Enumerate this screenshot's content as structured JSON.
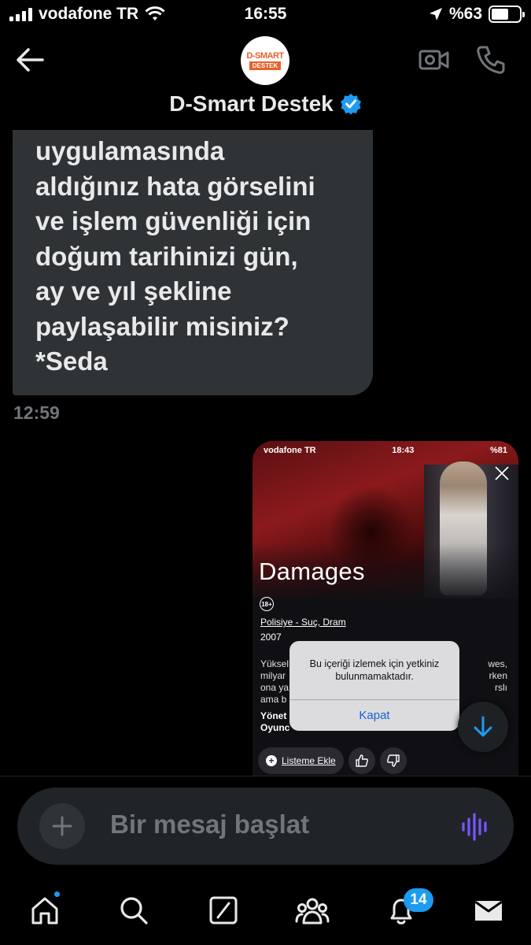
{
  "status_bar": {
    "carrier": "vodafone TR",
    "time": "16:55",
    "battery": "%63",
    "battery_level": 0.63
  },
  "header": {
    "contact_name": "D-Smart Destek",
    "avatar_top": "D-SMART",
    "avatar_bottom": "DESTEK",
    "icons": [
      "back-arrow-icon",
      "verified-badge-icon",
      "video-camera-icon",
      "phone-icon"
    ]
  },
  "conversation": {
    "incoming_message": "uygulamasında\naldığınız hata görselini\nve  işlem güvenliği için\ndoğum tarihinizi gün,\nay ve yıl şekline\npaylaşabilir misiniz?\n*Seda",
    "incoming_time": "12:59"
  },
  "attachment": {
    "status_carrier": "vodafone TR",
    "status_time": "18:43",
    "status_battery": "%81",
    "title": "Damages",
    "age_rating": "18+",
    "genre": "Polisiye - Suç, Dram",
    "year": "2007",
    "desc_left": [
      "Yüksel",
      "milyar",
      "ona ya",
      "ama b"
    ],
    "desc_right": [
      "wes,",
      "rken",
      "rslı"
    ],
    "credit_1": "Yönet",
    "credit_2": "Oyunc",
    "alert_message": "Bu içeriği izlemek için yetkiniz bulunmamaktadır.",
    "alert_button": "Kapat",
    "add_to_list": "Listeme Ekle"
  },
  "composer": {
    "placeholder": "Bir mesaj başlat"
  },
  "tabbar": {
    "items": [
      "home-icon",
      "search-icon",
      "grok-icon",
      "communities-icon",
      "notifications-icon",
      "messages-icon"
    ],
    "notification_count": "14"
  },
  "colors": {
    "background": "#000000",
    "bubble": "#2f3336",
    "accent": "#1d9bf0",
    "muted": "#71767b",
    "voice": "#7856ff"
  }
}
